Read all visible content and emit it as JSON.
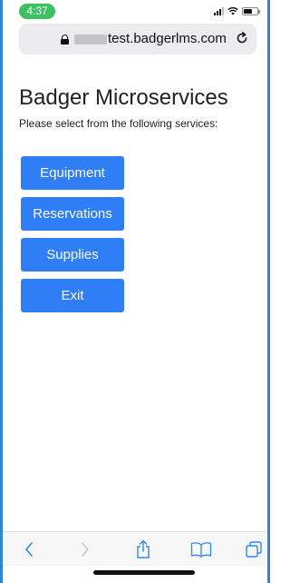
{
  "status_bar": {
    "time": "4:37"
  },
  "browser": {
    "url": "test.badgerlms.com",
    "lock_icon": "lock-icon",
    "reload_icon": "reload-icon"
  },
  "page": {
    "title": "Badger Microservices",
    "subtitle": "Please select from the following services:",
    "services": [
      {
        "label": "Equipment"
      },
      {
        "label": "Reservations"
      },
      {
        "label": "Supplies"
      },
      {
        "label": "Exit"
      }
    ],
    "accent_color": "#2f7ef6"
  },
  "toolbar": {
    "items": [
      "back-icon",
      "forward-icon",
      "share-icon",
      "bookmarks-icon",
      "tabs-icon"
    ]
  }
}
